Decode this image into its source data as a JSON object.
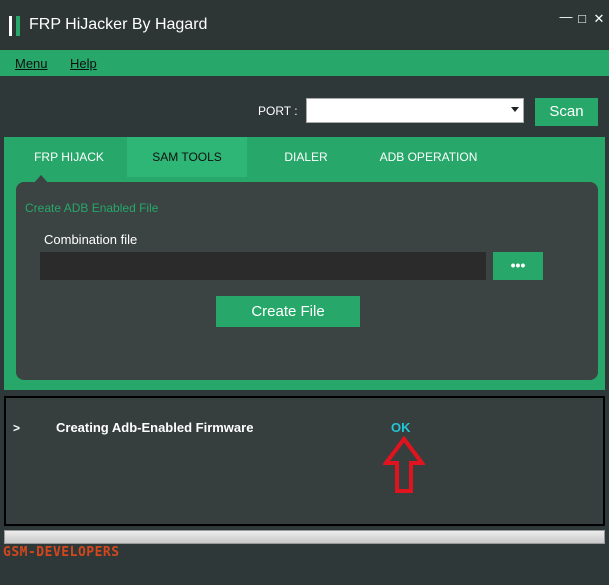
{
  "window": {
    "title": "FRP HiJacker By Hagard",
    "controls": [
      "minimize",
      "maximize",
      "close"
    ]
  },
  "menu": {
    "items": [
      {
        "label": "Menu"
      },
      {
        "label": "Help"
      }
    ]
  },
  "port": {
    "label": "PORT :",
    "selected": ""
  },
  "scan_button": "Scan",
  "tabs": [
    {
      "label": "FRP HIJACK",
      "active": false
    },
    {
      "label": "SAM TOOLS",
      "active": true
    },
    {
      "label": "DIALER",
      "active": false
    },
    {
      "label": "ADB OPERATION",
      "active": false
    }
  ],
  "panel": {
    "section_title": "Create ADB Enabled File",
    "combination_label": "Combination file",
    "combination_value": "",
    "browse_label": "•••",
    "create_button": "Create File"
  },
  "log": {
    "prompt": ">",
    "message": "Creating Adb-Enabled Firmware",
    "status": "OK"
  },
  "watermark": "GSM-DEVELOPERS",
  "colors": {
    "accent": "#27a86a",
    "background": "#2f3838",
    "panel": "#3b4343",
    "ok": "#22c3d5",
    "annotation": "#e0141e"
  }
}
